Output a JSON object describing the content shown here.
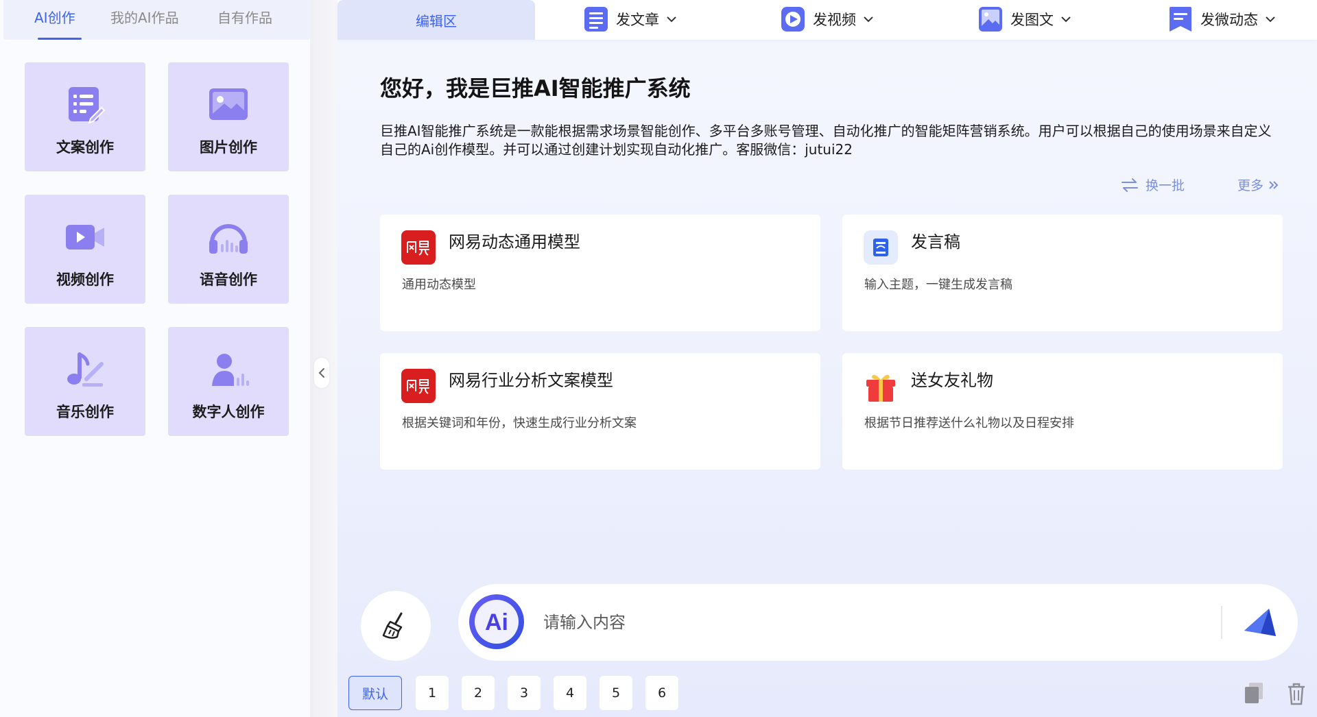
{
  "left_tabs": [
    "AI创作",
    "我的AI作品",
    "自有作品"
  ],
  "create_cards": [
    {
      "label": "文案创作",
      "icon": "document-edit-icon"
    },
    {
      "label": "图片创作",
      "icon": "image-icon"
    },
    {
      "label": "视频创作",
      "icon": "video-camera-icon"
    },
    {
      "label": "语音创作",
      "icon": "headphones-icon"
    },
    {
      "label": "音乐创作",
      "icon": "music-note-icon"
    },
    {
      "label": "数字人创作",
      "icon": "digital-human-icon"
    }
  ],
  "topbar": {
    "edit_tab": "编辑区",
    "menus": [
      {
        "label": "发文章",
        "icon": "article-icon"
      },
      {
        "label": "发视频",
        "icon": "video-play-icon"
      },
      {
        "label": "发图文",
        "icon": "picture-post-icon"
      },
      {
        "label": "发微动态",
        "icon": "micro-post-icon"
      }
    ]
  },
  "main": {
    "greeting": "您好，我是巨推AI智能推广系统",
    "intro": "巨推AI智能推广系统是一款能根据需求场景智能创作、多平台多账号管理、自动化推广的智能矩阵营销系统。用户可以根据自己的使用场景来自定义自己的Ai创作模型。并可以通过创建计划实现自动化推广。客服微信：jutui22",
    "refresh_label": "换一批",
    "more_label": "更多",
    "models": [
      {
        "title": "网易动态通用模型",
        "desc": "通用动态模型",
        "icon": "netease-logo-icon"
      },
      {
        "title": "发言稿",
        "desc": "输入主题，一键生成发言稿",
        "icon": "speech-doc-icon"
      },
      {
        "title": "网易行业分析文案模型",
        "desc": "根据关键词和年份，快速生成行业分析文案",
        "icon": "netease-logo-icon"
      },
      {
        "title": "送女友礼物",
        "desc": "根据节日推荐送什么礼物以及日程安排",
        "icon": "gift-icon"
      }
    ]
  },
  "input": {
    "placeholder": "请输入内容",
    "ai_badge": "Ai"
  },
  "presets": [
    "默认",
    "1",
    "2",
    "3",
    "4",
    "5",
    "6"
  ],
  "colors": {
    "accent": "#3d63f5",
    "card_bg": "#e1dcfb",
    "icon_purple": "#8b7ff0",
    "link": "#7b8fe0",
    "netease_red": "#d81e1e"
  }
}
